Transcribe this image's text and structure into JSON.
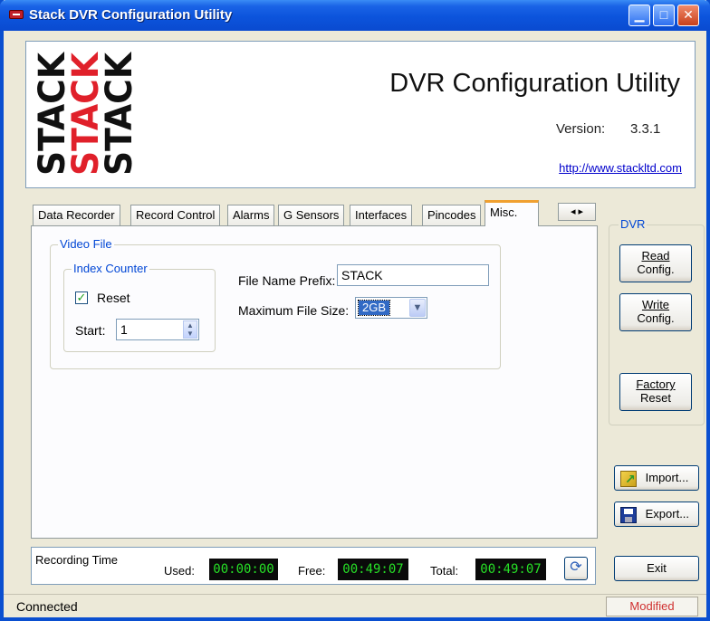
{
  "window": {
    "title": "Stack DVR Configuration Utility"
  },
  "header": {
    "logo_words": [
      "STACK",
      "STACK",
      "STACK"
    ],
    "title": "DVR Configuration Utility",
    "version_label": "Version:",
    "version_value": "3.3.1",
    "url": "http://www.stackltd.com"
  },
  "tabs": [
    "Data Recorder",
    "Record Control",
    "Alarms",
    "G Sensors",
    "Interfaces",
    "Pincodes",
    "Misc."
  ],
  "active_tab": "Misc.",
  "misc": {
    "video_file_label": "Video File",
    "index_counter_label": "Index Counter",
    "reset_label": "Reset",
    "reset_checked": true,
    "start_label": "Start:",
    "start_value": "1",
    "prefix_label": "File Name Prefix:",
    "prefix_value": "STACK",
    "max_size_label": "Maximum File Size:",
    "max_size_value": "2GB"
  },
  "dvr_panel": {
    "label": "DVR",
    "read_line1": "Read",
    "read_line2": "Config.",
    "write_line1": "Write",
    "write_line2": "Config.",
    "factory_line1": "Factory",
    "factory_line2": "Reset"
  },
  "import_label": "Import...",
  "export_label": "Export...",
  "exit_label": "Exit",
  "recording": {
    "label": "Recording Time",
    "used_label": "Used:",
    "used_value": "00:00:00",
    "free_label": "Free:",
    "free_value": "00:49:07",
    "total_label": "Total:",
    "total_value": "00:49:07"
  },
  "status": {
    "left": "Connected",
    "right": "Modified"
  },
  "colors": {
    "logo_black": "#111111",
    "logo_red": "#e0202a",
    "lcd_text": "#27e027",
    "accent_blue": "#0046d5"
  }
}
